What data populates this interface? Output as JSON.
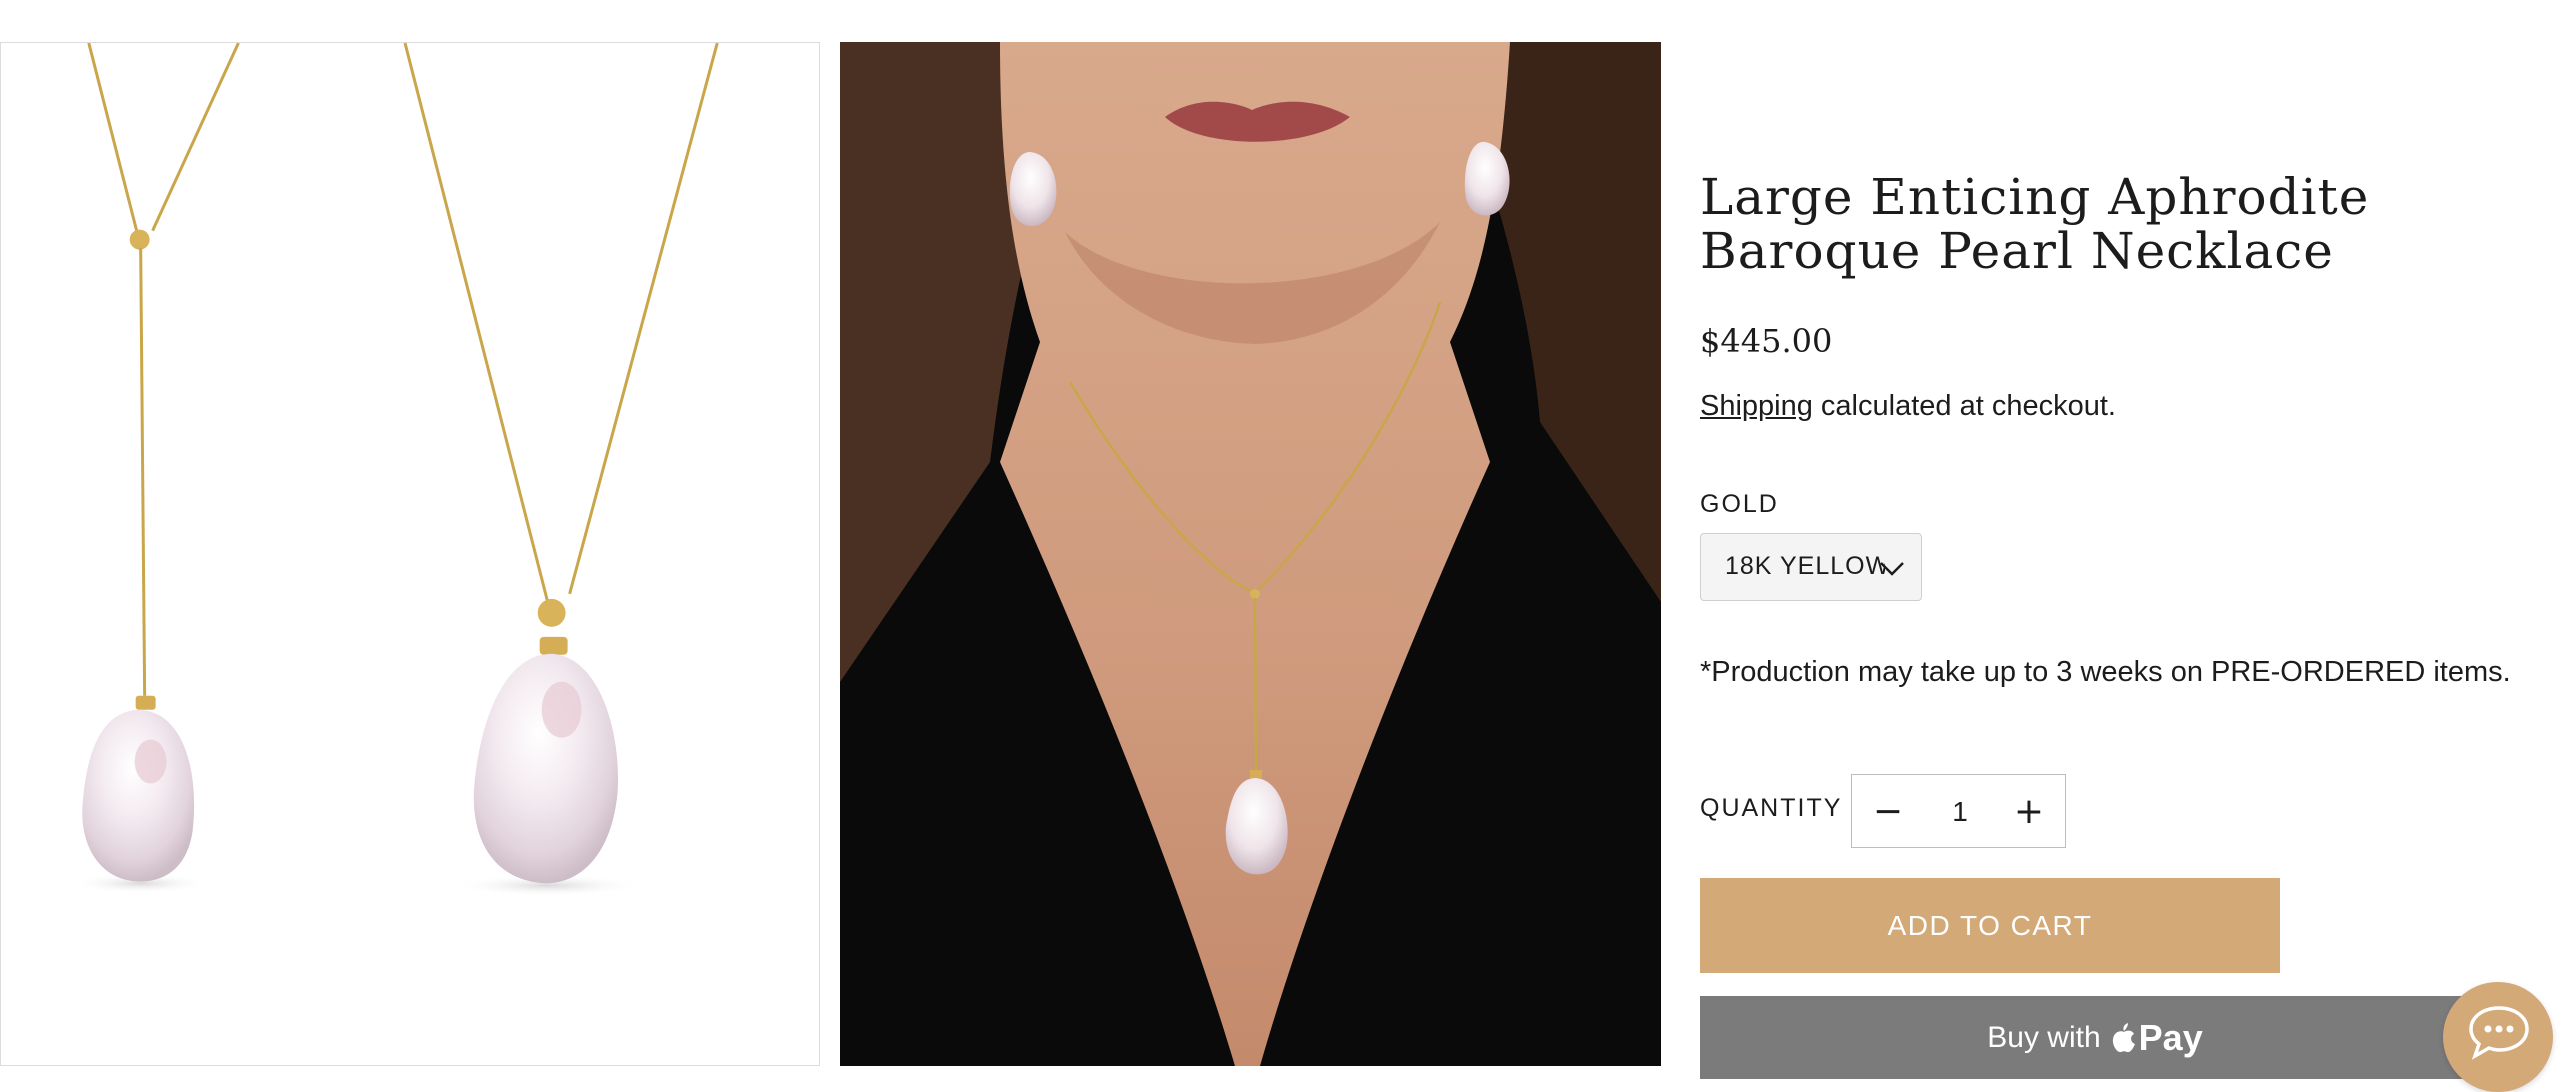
{
  "gallery": {
    "images": [
      {
        "name": "product-photo-pearl-necklaces",
        "alt": ""
      },
      {
        "name": "model-wearing-necklace",
        "alt": ""
      }
    ]
  },
  "product": {
    "title": "Large Enticing Aphrodite Baroque Pearl Necklace",
    "price": "$445.00",
    "shipping_link": "Shipping",
    "shipping_suffix": " calculated at checkout.",
    "option_label": "GOLD",
    "option_selected": "18K YELLOW",
    "note": "*Production may take up to 3 weeks on PRE-ORDERED items.",
    "quantity_label": "QUANTITY",
    "quantity_value": "1",
    "minus_symbol": "−",
    "plus_symbol": "+",
    "add_to_cart": "ADD TO CART",
    "buy_with_prefix": "Buy with",
    "pay_brand": "Pay"
  },
  "icons": {
    "chevron": "chevron-down-icon",
    "apple": "apple-logo-icon",
    "chat": "chat-bubble-icon"
  },
  "colors": {
    "accent": "#d3a978",
    "pay_button": "#7b7b7b",
    "select_bg": "#f4f4f4"
  }
}
